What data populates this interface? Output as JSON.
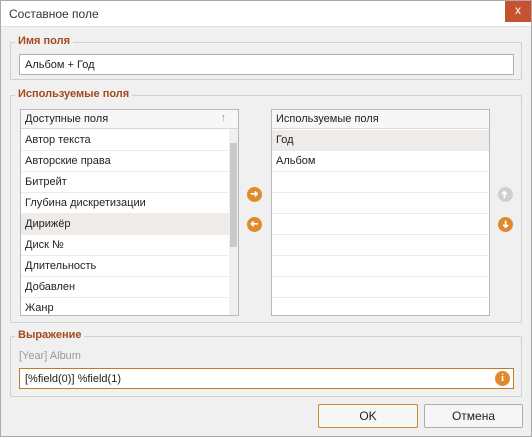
{
  "window": {
    "title": "Составное поле",
    "close_label": "x"
  },
  "field_name": {
    "legend": "Имя поля",
    "value": "Альбом + Год"
  },
  "used_fields_group": {
    "legend": "Используемые поля"
  },
  "available_list": {
    "header": "Доступные поля",
    "items": [
      "Автор текста",
      "Авторские права",
      "Битрейт",
      "Глубина дискретизации",
      "Дирижёр",
      "Диск №",
      "Длительность",
      "Добавлен",
      "Жанр"
    ],
    "selected_index": 4
  },
  "used_list": {
    "header": "Используемые поля",
    "items": [
      "Год",
      "Альбом"
    ],
    "selected_index": 0
  },
  "expression": {
    "legend": "Выражение",
    "preview": "[Year] Album",
    "value": "[%field(0)] %field(1)"
  },
  "buttons": {
    "ok": "OK",
    "cancel": "Отмена"
  },
  "icons": {
    "move_right": "arrow-right-icon",
    "move_left": "arrow-left-icon",
    "move_up": "arrow-up-icon",
    "move_down": "arrow-down-icon",
    "info": "info-icon"
  },
  "colors": {
    "accent": "#e08a2d",
    "legend": "#a34a20",
    "close": "#c7522f"
  }
}
